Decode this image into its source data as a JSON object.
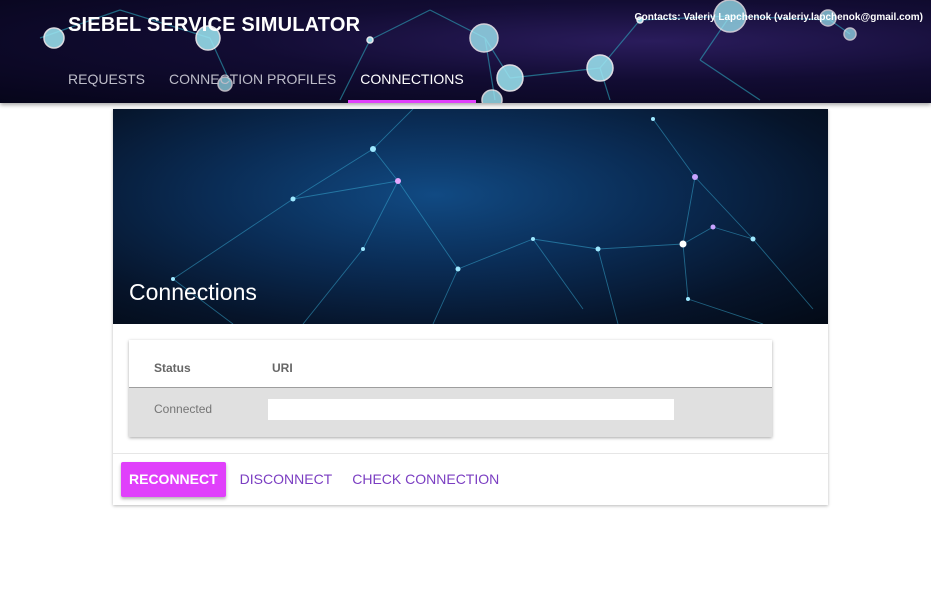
{
  "app": {
    "title": "SIEBEL SERVICE SIMULATOR",
    "contacts": "Contacts: Valeriy Lapchenok (valeriy.lapchenok@gmail.com)"
  },
  "nav": {
    "tabs": [
      {
        "label": "REQUESTS",
        "active": false
      },
      {
        "label": "CONNECTION PROFILES",
        "active": false
      },
      {
        "label": "CONNECTIONS",
        "active": true
      }
    ]
  },
  "page": {
    "title": "Connections"
  },
  "table": {
    "headers": {
      "status": "Status",
      "uri": "URI"
    },
    "rows": [
      {
        "status": "Connected",
        "uri": ""
      }
    ]
  },
  "actions": {
    "reconnect": "RECONNECT",
    "disconnect": "DISCONNECT",
    "check_connection": "CHECK CONNECTION"
  },
  "colors": {
    "accent": "#e040fb",
    "link": "#7b3ec2",
    "row_bg": "#e0e0e0"
  }
}
